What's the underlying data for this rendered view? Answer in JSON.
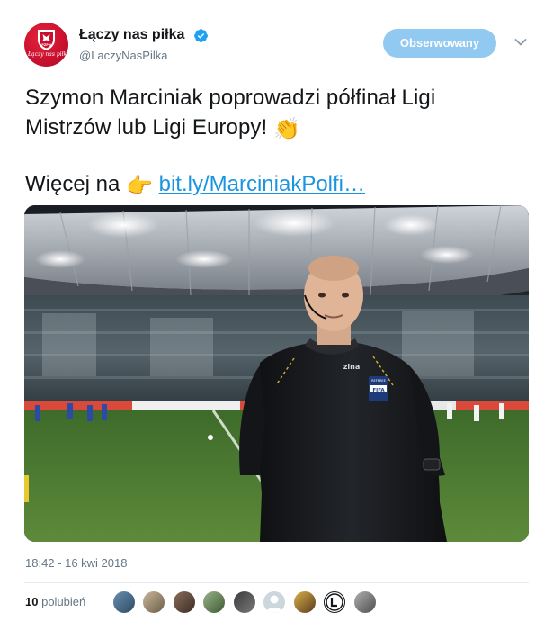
{
  "account": {
    "display_name": "Łączy nas piłka",
    "handle": "@LaczyNasPilka",
    "verified": true,
    "avatar_icon": "pzpn-crest-icon",
    "avatar_script": "Łączy nas piłka",
    "avatar_color": "#c8102e"
  },
  "header": {
    "follow_button_label": "Obserwowany",
    "more_menu_icon": "chevron-down-icon"
  },
  "tweet": {
    "line1": "Szymon Marciniak poprowadzi półfinał Ligi",
    "line2": "Mistrzów lub Ligi Europy! ",
    "clap_emoji": "👏",
    "more_prefix": "Więcej na ",
    "pointing_emoji": "👉",
    "link_text": "bit.ly/MarciniakPolfi…"
  },
  "photo": {
    "kit_brand": "zina",
    "badge_text": "FIFA",
    "badge_caption": "REFEREE"
  },
  "meta": {
    "timestamp": "18:42 - 16 kwi 2018",
    "likes_count": "10",
    "likes_label": "polubień"
  },
  "colors": {
    "accent": "#1b95e0",
    "follow_button_bg": "#91c9f0",
    "secondary_text": "#657786",
    "divider": "#e6ecf0"
  }
}
